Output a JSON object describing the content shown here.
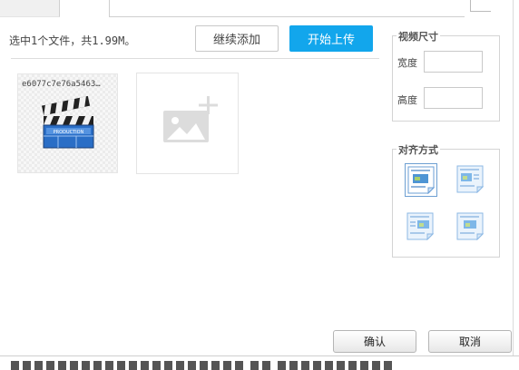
{
  "status": {
    "text": "选中1个文件，共1.99M。"
  },
  "toolbar": {
    "add_label": "继续添加",
    "upload_label": "开始上传"
  },
  "files": [
    {
      "name": "e6077c7e76a5463…",
      "icon": "film-clapperboard-icon",
      "caption": "PRODUCTION"
    }
  ],
  "add_tile": {
    "icon": "add-image-icon"
  },
  "video_size": {
    "title": "视频尺寸",
    "width_label": "宽度",
    "width_value": "",
    "height_label": "高度",
    "height_value": ""
  },
  "alignment": {
    "title": "对齐方式",
    "options": [
      {
        "name": "none",
        "selected": true
      },
      {
        "name": "left",
        "selected": false
      },
      {
        "name": "right",
        "selected": false
      },
      {
        "name": "center",
        "selected": false
      }
    ]
  },
  "footer": {
    "confirm_label": "确认",
    "cancel_label": "取消"
  },
  "colors": {
    "accent": "#12a6ec",
    "border": "#d4d4d4",
    "selected_border": "#6d9fd2"
  }
}
